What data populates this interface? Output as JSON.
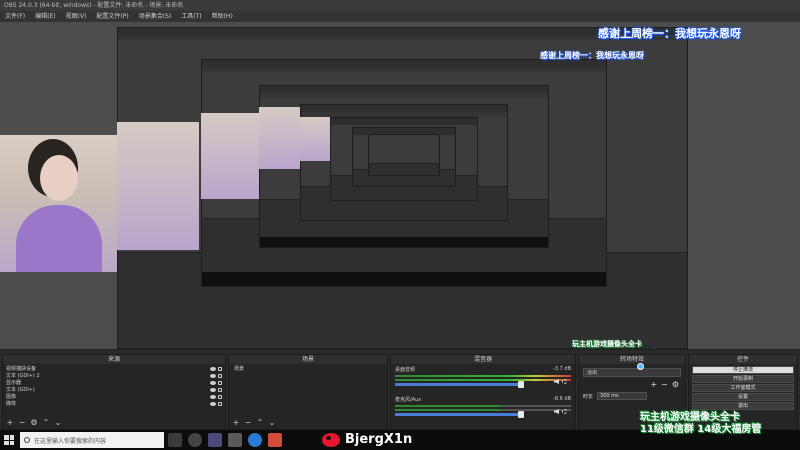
{
  "window": {
    "title": "OBS 24.0.3 (64-bit, windows) - 配置文件: 未命名 - 场景: 未命名"
  },
  "menu": [
    "文件(F)",
    "编辑(E)",
    "视图(V)",
    "配置文件(P)",
    "场景集合(S)",
    "工具(T)",
    "帮助(H)"
  ],
  "overlay": {
    "danmu_top": "感谢上周榜一：我想玩永恩呀",
    "danmu_mid": "感谢上周榜一：我想玩永恩呀",
    "gift_line1": "玩主机游戏摄像头全卡",
    "gift_line2": "11级微信群 14级大福房管",
    "brand": "BjergX1n"
  },
  "docks": {
    "sources": {
      "title": "来源",
      "items": [
        "视频捕获设备",
        "文本 (GDI+) 2",
        "显示器",
        "文本 (GDI+)",
        "图像",
        "媒体"
      ]
    },
    "scenes": {
      "title": "场景",
      "items": [
        "场景"
      ]
    },
    "mixer": {
      "title": "混音器",
      "channels": [
        {
          "name": "桌面音频",
          "db": "-3.7 dB",
          "level": 0.8
        },
        {
          "name": "麦克风/Aux",
          "db": "-8.6 dB",
          "level": 0.6
        }
      ]
    },
    "transitions": {
      "title": "转场特效",
      "selected": "淡出",
      "duration_label": "时长",
      "duration": "300 ms"
    },
    "controls": {
      "title": "控件",
      "buttons": [
        "停止推流",
        "开始录制",
        "工作室模式",
        "设置",
        "退出"
      ]
    }
  },
  "taskbar": {
    "search_placeholder": "在这里输入你要搜索的内容"
  },
  "colors": {
    "accent": "#4a7dd6",
    "weibo": "#e6162d",
    "overlay_text_glow": "#1a5cff",
    "gift_glow": "#1c8f3a"
  }
}
